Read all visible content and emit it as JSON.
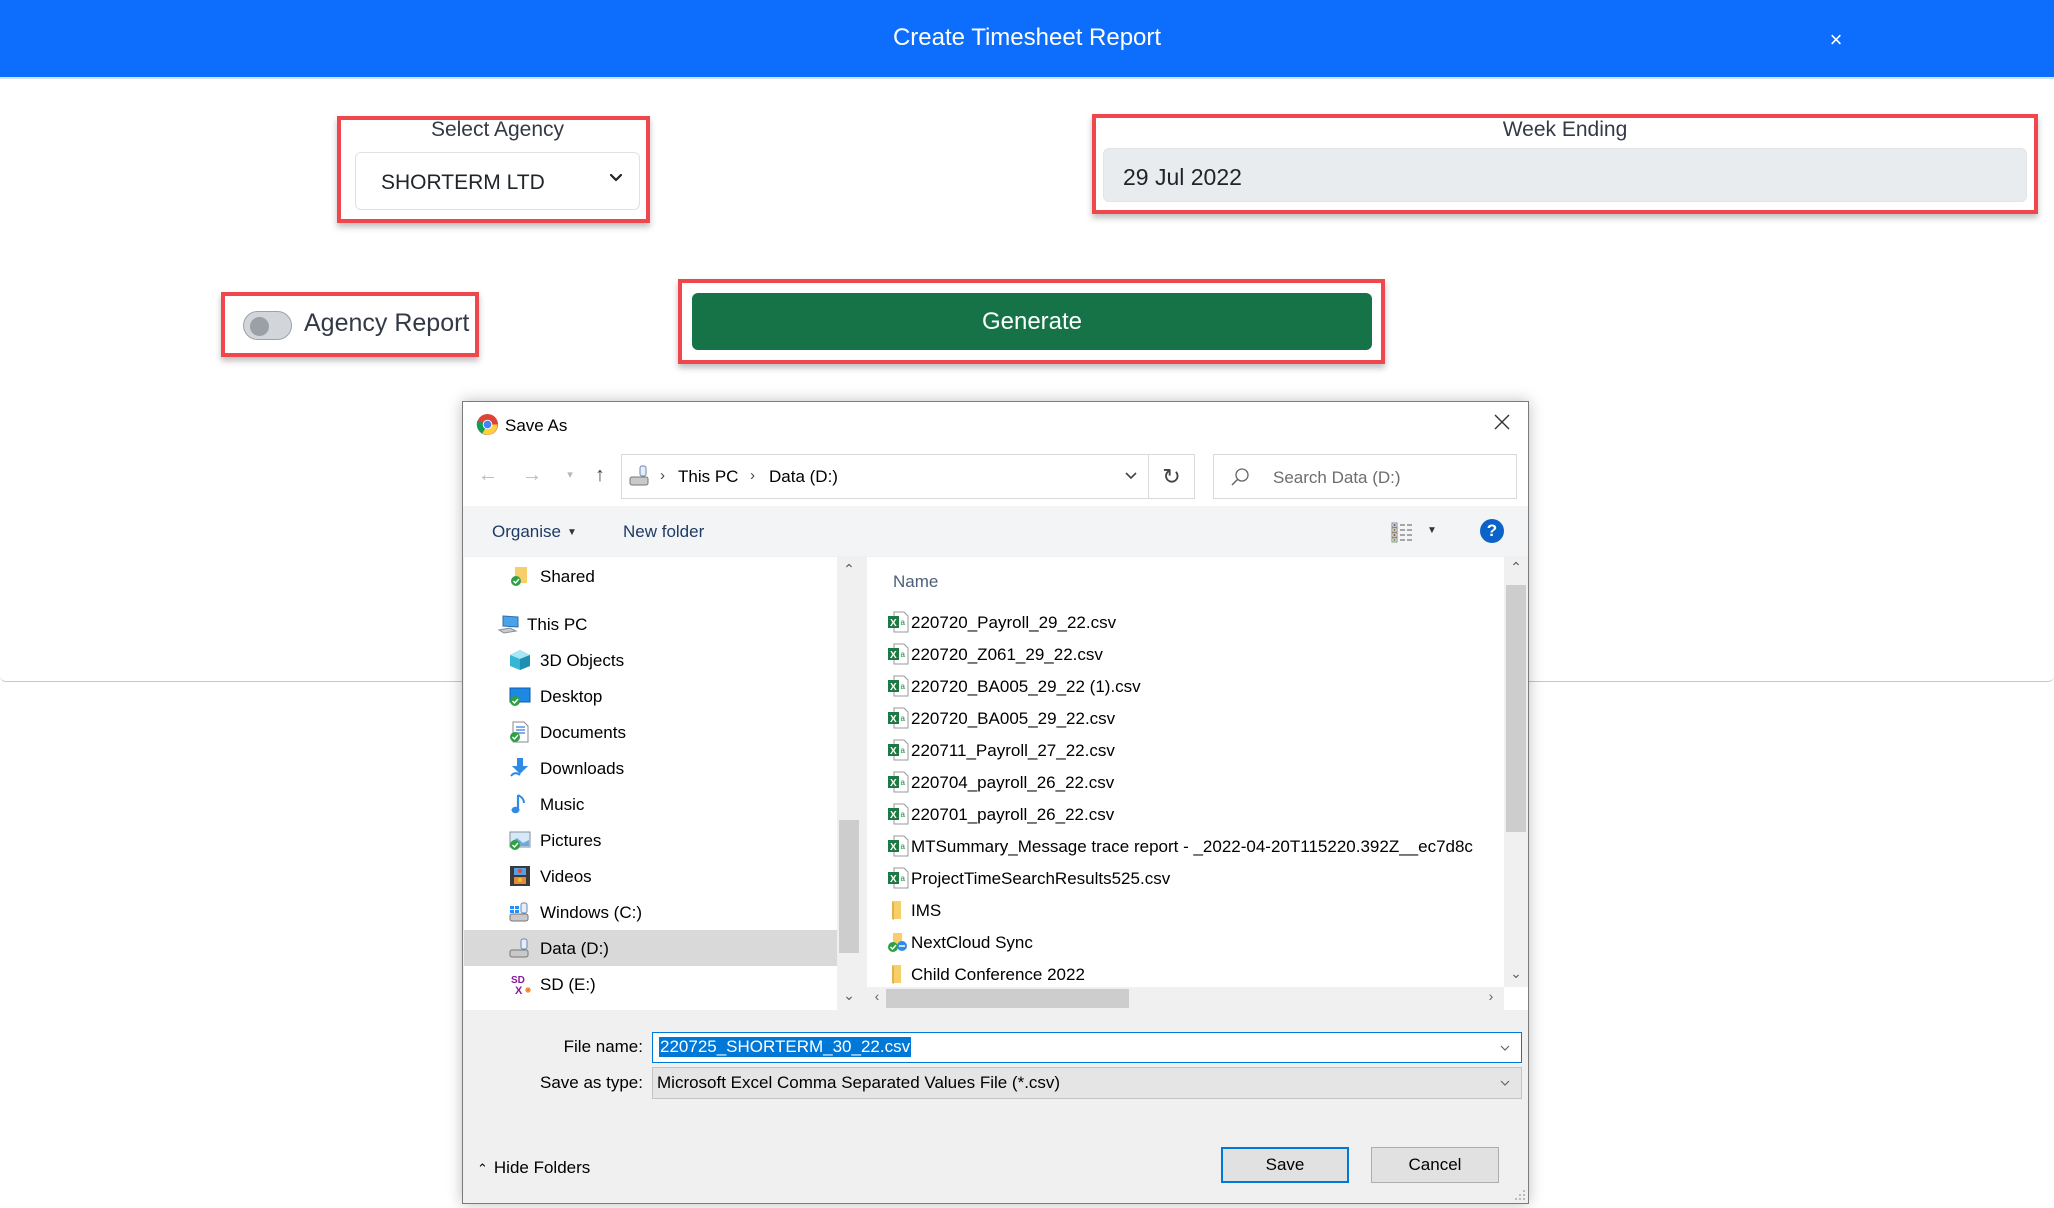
{
  "modal": {
    "title": "Create Timesheet Report",
    "close_glyph": "×",
    "header_color": "#0d6efd",
    "agency": {
      "label": "Select Agency",
      "selected": "SHORTERM LTD"
    },
    "week_ending": {
      "label": "Week Ending",
      "value": "29 Jul 2022"
    },
    "agency_report_toggle": {
      "label": "Agency Report",
      "checked": false
    },
    "generate_button": {
      "label": "Generate",
      "color": "#157347"
    },
    "highlight_color": "#f0474d"
  },
  "save_dialog": {
    "title": "Save As",
    "app_icon": "chrome-icon",
    "address": {
      "crumbs": [
        "This PC",
        "Data (D:)"
      ],
      "separator": "›"
    },
    "search_placeholder": "Search Data (D:)",
    "toolbar": {
      "organise": "Organise",
      "new_folder": "New folder",
      "help": "?"
    },
    "nav_items": [
      {
        "label": "Shared",
        "icon": "shared-folder-icon",
        "level": 2
      },
      {
        "label": "This PC",
        "icon": "this-pc-icon",
        "level": 1
      },
      {
        "label": "3D Objects",
        "icon": "3d-objects-icon",
        "level": 2
      },
      {
        "label": "Desktop",
        "icon": "desktop-icon",
        "level": 2
      },
      {
        "label": "Documents",
        "icon": "documents-icon",
        "level": 2
      },
      {
        "label": "Downloads",
        "icon": "downloads-icon",
        "level": 2
      },
      {
        "label": "Music",
        "icon": "music-icon",
        "level": 2
      },
      {
        "label": "Pictures",
        "icon": "pictures-icon",
        "level": 2
      },
      {
        "label": "Videos",
        "icon": "videos-icon",
        "level": 2
      },
      {
        "label": "Windows (C:)",
        "icon": "windows-drive-icon",
        "level": 2
      },
      {
        "label": "Data (D:)",
        "icon": "data-drive-icon",
        "level": 2,
        "selected": true
      },
      {
        "label": "SD (E:)",
        "icon": "sd-card-icon",
        "level": 2
      }
    ],
    "file_list": {
      "column_header": "Name",
      "items": [
        {
          "name": "220720_Payroll_29_22.csv",
          "type": "csv"
        },
        {
          "name": "220720_Z061_29_22.csv",
          "type": "csv"
        },
        {
          "name": "220720_BA005_29_22 (1).csv",
          "type": "csv"
        },
        {
          "name": "220720_BA005_29_22.csv",
          "type": "csv"
        },
        {
          "name": "220711_Payroll_27_22.csv",
          "type": "csv"
        },
        {
          "name": "220704_payroll_26_22.csv",
          "type": "csv"
        },
        {
          "name": "220701_payroll_26_22.csv",
          "type": "csv"
        },
        {
          "name": "MTSummary_Message trace report - _2022-04-20T115220.392Z__ec7d8c",
          "type": "csv"
        },
        {
          "name": "ProjectTimeSearchResults525.csv",
          "type": "csv"
        },
        {
          "name": "IMS",
          "type": "folder"
        },
        {
          "name": "NextCloud Sync",
          "type": "sync-folder"
        },
        {
          "name": "Child Conference 2022",
          "type": "folder"
        }
      ]
    },
    "file_name": {
      "label": "File name:",
      "value": "220725_SHORTERM_30_22.csv"
    },
    "save_as_type": {
      "label": "Save as type:",
      "value": "Microsoft Excel Comma Separated Values File (*.csv)"
    },
    "hide_folders": "Hide Folders",
    "save_button": "Save",
    "cancel_button": "Cancel"
  }
}
